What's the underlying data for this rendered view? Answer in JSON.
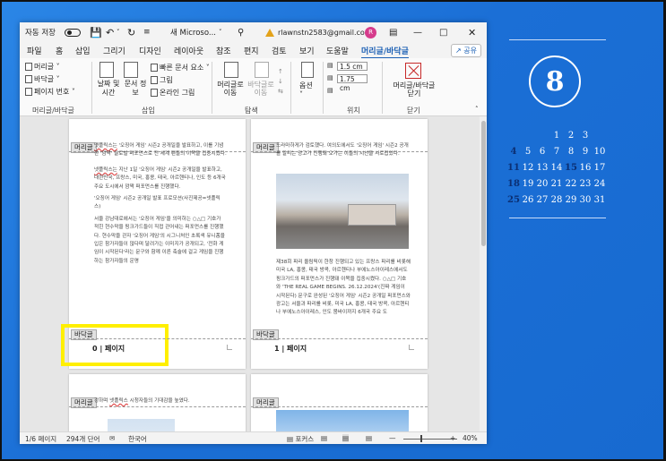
{
  "titlebar": {
    "autosave_label": "자동 저장",
    "autosave_state": "끔",
    "doc_name": "새 Microso...",
    "account_email": "rlawnstn2583@gmail.com",
    "avatar_initial": "R"
  },
  "menu": {
    "items": [
      "파일",
      "홈",
      "삽입",
      "그리기",
      "디자인",
      "레이아웃",
      "참조",
      "편지",
      "검토",
      "보기",
      "도움말",
      "머리글/바닥글"
    ],
    "share_label": "공유"
  },
  "ribbon": {
    "header_label": "머리글",
    "footer_label": "바닥글",
    "page_number_label": "페이지 번호",
    "group1_label": "머리글/바닥글",
    "date_time_label": "날짜 및 시간",
    "doc_info_label": "문서 정보",
    "quick_parts_label": "빠른 문서 요소",
    "picture_label": "그림",
    "online_picture_label": "온라인 그림",
    "insert_group_label": "삽입",
    "goto_header_label": "머리글로 이동",
    "goto_footer_label": "바닥글로 이동",
    "nav_group_label": "탐색",
    "options_label": "옵션",
    "header_pos": "1.5 cm",
    "footer_pos": "1.75 cm",
    "position_group_label": "위치",
    "close_label": "머리글/바닥글 닫기",
    "close_group_label": "닫기"
  },
  "pages": {
    "header_tag": "머리글",
    "footer_tag": "바닥글",
    "p1": {
      "para1": "'오징어 게임' 시즌2 공개일을 발표하고, 이를 기념한 '깜짝' 글로벌 퍼포먼스로 전 세계 팬들의 이목을 집중시켰다.",
      "para1_lead": "넷플릭스는",
      "para2_lead": "넷플릭스는",
      "para2": " 지난 1일 '오징어 게임' 시즌2 공개일을 발표하고, 대한민국, 프랑스, 미국, 홍콩, 태국, 아르헨티나, 인도 등 6개국 주요 도시에서 깜짝 퍼포먼스를 진행했다.",
      "para3": "'오징어 게임' 시즌2 공개일 발표 프로모션(사진제공=넷플릭스)",
      "para4": "서울 강남대로에서는 '오징어 게임'을 의미하는 ○△□ 기호가 적힌 현수막을 핑크가드들이 직접 걷어내는 퍼포먼스를 진행했다. 현수막을 걷자 '오징어 게임'의 시그니처인 초록색 유니폼을 입은 참가자들이 많다며 달려가는 이미지가 공개되고, '전화 게임이 시작된다'라는 문구와 함께 이른 축술에 걸고 게임을 진행하는 참가자들의 운명",
      "page_num": "0 | 페이지"
    },
    "p2": {
      "para1": "드라마하게가 검토했다. 여의도에서도 '오징어 게임' 시즌2 공개를 알리는 광고가 진행돼 오가는 이들의 시선을 사로잡았다.",
      "para2": "제38회 파리 올림픽이 한창 진행되고 있는 프랑스 파리를 비롯해 미국 LA, 홍콩, 태국 방콕, 아르헨티나 부에노스아이레스에서도 핑크가드의 퍼포먼스가 진행돼 이목을 집중시켰다. ○△□ 기호와 'THE REAL GAME BEGINS. 26.12.2024'(진짜 게임이 시작된다) 문구로 완성된 '오징어 게임' 시즌2 공개일 퍼포먼스와 광고는 서울과 파리를 비롯, 미국 LA, 홍콩, 태국 방콕, 아르헨티나 부에노스아이레스, 인도 뭄바이까지 6개국 주요 도",
      "page_num": "1 | 페이지"
    },
    "p3": {
      "para1_pre": "강하며 ",
      "para1_ul": "넷플릭스",
      "para1_post": " 시청자들의 기대감을 높였다."
    }
  },
  "calendar": {
    "month": "8",
    "days": [
      "",
      "",
      "",
      "1",
      "2",
      "3",
      "",
      "4",
      "5",
      "6",
      "7",
      "8",
      "9",
      "10",
      "11",
      "12",
      "13",
      "14",
      "15",
      "16",
      "17",
      "18",
      "19",
      "20",
      "21",
      "22",
      "23",
      "24",
      "25",
      "26",
      "27",
      "28",
      "29",
      "30",
      "31"
    ],
    "bold_days": [
      "4",
      "11",
      "15",
      "18",
      "25"
    ]
  },
  "statusbar": {
    "pages": "1/6 페이지",
    "words": "294개 단어",
    "language": "한국어",
    "focus": "포커스",
    "zoom": "40%"
  }
}
